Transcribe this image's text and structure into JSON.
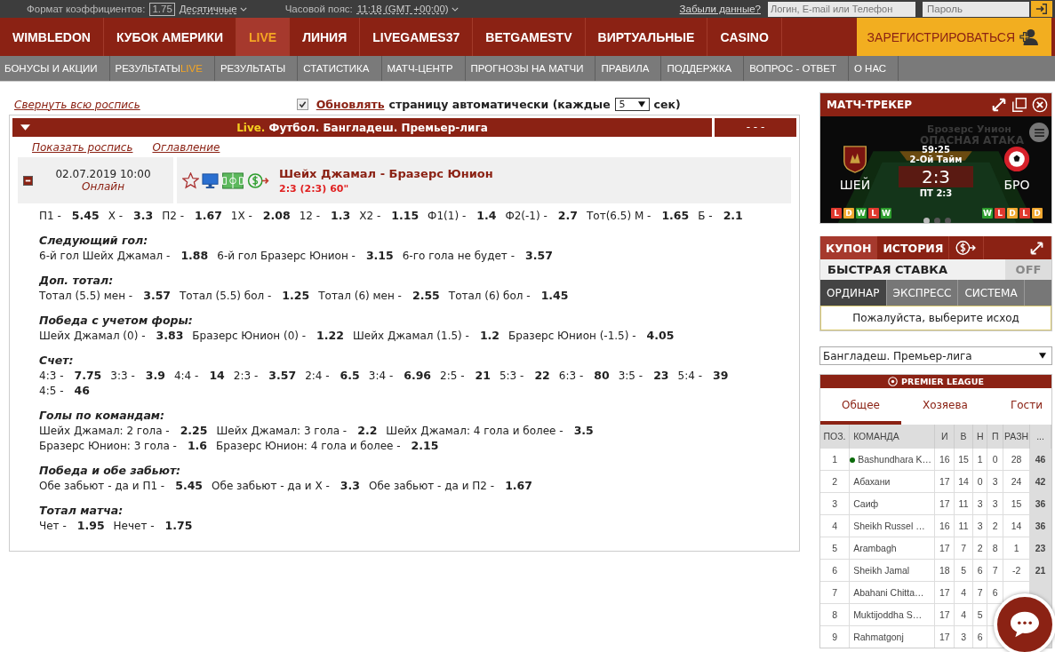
{
  "top_bar": {
    "odds_format_label": "Формат коэффициентов:",
    "odds_sample": "1.75",
    "odds_format": "Десятичные",
    "timezone_label": "Часовой пояс:",
    "timezone": "11:18 (GMT +00:00)",
    "forgot_link": "Забыли данные?",
    "login_placeholder": "Логин, E-mail или Телефон",
    "password_placeholder": "Пароль"
  },
  "main_nav": [
    {
      "label": "WIMBLEDON",
      "selected": false
    },
    {
      "label": "КУБОК АМЕРИКИ",
      "selected": false
    },
    {
      "label": "LIVE",
      "selected": true
    },
    {
      "label": "ЛИНИЯ",
      "selected": false
    },
    {
      "label": "LIVEGAMES37",
      "selected": false
    },
    {
      "label": "BETGAMESTV",
      "selected": false
    },
    {
      "label": "ВИРТУАЛЬНЫЕ",
      "selected": false
    },
    {
      "label": "CASINO",
      "selected": false
    }
  ],
  "register_button": "ЗАРЕГИСТРИРОВАТЬСЯ",
  "sub_nav": [
    {
      "label": "БОНУСЫ И АКЦИИ"
    },
    {
      "label": "РЕЗУЛЬТАТЫ",
      "accent": "LIVE"
    },
    {
      "label": "РЕЗУЛЬТАТЫ"
    },
    {
      "label": "СТАТИСТИКА"
    },
    {
      "label": "МАТЧ-ЦЕНТР"
    },
    {
      "label": "ПРОГНОЗЫ НА МАТЧИ"
    },
    {
      "label": "ПРАВИЛА"
    },
    {
      "label": "ПОДДЕРЖКА"
    },
    {
      "label": "ВОПРОС - ОТВЕТ"
    },
    {
      "label": "О НАС"
    }
  ],
  "collapse_link": "Свернуть всю роспись",
  "auto_refresh": {
    "checked": true,
    "link": "Обновлять",
    "text": "страницу автоматически (каждые",
    "interval": "5",
    "unit": "сек)"
  },
  "league_header": {
    "prefix": "Live.",
    "title": "Футбол. Бангладеш. Премьер-лига",
    "extra": "- - -"
  },
  "league_links": [
    "Показать роспись",
    "Оглавление"
  ],
  "event": {
    "date": "02.07.2019 10:00",
    "status": "Онлайн",
    "name": "Шейх Джамал - Бразерс Юнион",
    "score": "2:3 (2:3) 60\""
  },
  "markets": [
    {
      "items": [
        {
          "label": "П1 -",
          "odd": "5.45"
        },
        {
          "label": "Х -",
          "odd": "3.3"
        },
        {
          "label": "П2 -",
          "odd": "1.67"
        },
        {
          "label": "1Х -",
          "odd": "2.08"
        },
        {
          "label": "12 -",
          "odd": "1.3"
        },
        {
          "label": "Х2 -",
          "odd": "1.15"
        },
        {
          "label": "Ф1(1) -",
          "odd": "1.4"
        },
        {
          "label": "Ф2(-1) -",
          "odd": "2.7"
        },
        {
          "label": "Тот(6.5) М -",
          "odd": "1.65"
        },
        {
          "label": "Б -",
          "odd": "2.1"
        }
      ]
    },
    {
      "title": "Следующий гол:",
      "items": [
        {
          "label": "6-й гол Шейх Джамал -",
          "odd": "1.88"
        },
        {
          "label": "6-й гол Бразерс Юнион -",
          "odd": "3.15"
        },
        {
          "label": "6-го гола не будет -",
          "odd": "3.57"
        }
      ]
    },
    {
      "title": "Доп. тотал:",
      "items": [
        {
          "label": "Тотал (5.5) мен -",
          "odd": "3.57"
        },
        {
          "label": "Тотал (5.5) бол -",
          "odd": "1.25"
        },
        {
          "label": "Тотал (6) мен -",
          "odd": "2.55"
        },
        {
          "label": "Тотал (6) бол -",
          "odd": "1.45"
        }
      ]
    },
    {
      "title": "Победа с учетом форы:",
      "items": [
        {
          "label": "Шейх Джамал (0) -",
          "odd": "3.83"
        },
        {
          "label": "Бразерс Юнион (0) -",
          "odd": "1.22"
        },
        {
          "label": "Шейх Джамал (1.5) -",
          "odd": "1.2"
        },
        {
          "label": "Бразерс Юнион (-1.5) -",
          "odd": "4.05"
        }
      ]
    },
    {
      "title": "Счет:",
      "items": [
        {
          "label": "4:3 -",
          "odd": "7.75"
        },
        {
          "label": "3:3 -",
          "odd": "3.9"
        },
        {
          "label": "4:4 -",
          "odd": "14"
        },
        {
          "label": "2:3 -",
          "odd": "3.57"
        },
        {
          "label": "2:4 -",
          "odd": "6.5"
        },
        {
          "label": "3:4 -",
          "odd": "6.96"
        },
        {
          "label": "2:5 -",
          "odd": "21"
        },
        {
          "label": "5:3 -",
          "odd": "22"
        },
        {
          "label": "6:3 -",
          "odd": "80"
        },
        {
          "label": "3:5 -",
          "odd": "23"
        },
        {
          "label": "5:4 -",
          "odd": "39"
        },
        {
          "label": "4:5 -",
          "odd": "46"
        }
      ]
    },
    {
      "title": "Голы по командам:",
      "items": [
        {
          "label": "Шейх Джамал: 2 гола -",
          "odd": "2.25"
        },
        {
          "label": "Шейх Джамал: 3 гола -",
          "odd": "2.2"
        },
        {
          "label": "Шейх Джамал: 4 гола и более -",
          "odd": "3.5"
        },
        {
          "label": "Бразерс Юнион: 3 гола -",
          "odd": "1.6"
        },
        {
          "label": "Бразерс Юнион: 4 гола и более -",
          "odd": "2.15"
        }
      ]
    },
    {
      "title": "Победа и обе забьют:",
      "items": [
        {
          "label": "Обе забьют - да и П1 -",
          "odd": "5.45"
        },
        {
          "label": "Обе забьют - да и Х -",
          "odd": "3.3"
        },
        {
          "label": "Обе забьют - да и П2 -",
          "odd": "1.67"
        }
      ]
    },
    {
      "title": "Тотал матча:",
      "items": [
        {
          "label": "Чет -",
          "odd": "1.95"
        },
        {
          "label": "Нечет -",
          "odd": "1.75"
        }
      ]
    }
  ],
  "tracker": {
    "title": "МАТЧ-ТРЕКЕР",
    "team_faded": "Брозерс Унион",
    "event_faded": "ОПАСНАЯ АТАКА",
    "clock": "59:25",
    "period": "2-Ой Тайм",
    "home": "ШЕЙ",
    "away": "БРО",
    "score": "2:3",
    "half": "ПТ 2:3",
    "home_form": [
      {
        "letter": "L",
        "color": "#e03a2f"
      },
      {
        "letter": "D",
        "color": "#f0a830"
      },
      {
        "letter": "W",
        "color": "#2e9e2e"
      },
      {
        "letter": "L",
        "color": "#e03a2f"
      },
      {
        "letter": "W",
        "color": "#2e9e2e"
      }
    ],
    "away_form": [
      {
        "letter": "W",
        "color": "#2e9e2e"
      },
      {
        "letter": "L",
        "color": "#e03a2f"
      },
      {
        "letter": "D",
        "color": "#f0a830"
      },
      {
        "letter": "L",
        "color": "#e03a2f"
      },
      {
        "letter": "D",
        "color": "#f0a830"
      }
    ],
    "pages": [
      {
        "selected": true
      },
      {
        "selected": false
      },
      {
        "selected": false
      }
    ]
  },
  "coupon": {
    "tabs": [
      {
        "label": "КУПОН",
        "selected": true
      },
      {
        "label": "ИСТОРИЯ",
        "selected": false
      }
    ],
    "quick_bet_label": "БЫСТРАЯ СТАВКА",
    "quick_bet": {
      "on": false,
      "label": "OFF"
    },
    "bet_types": [
      {
        "label": "ОРДИНАР",
        "selected": true
      },
      {
        "label": "ЭКСПРЕСС",
        "selected": false
      },
      {
        "label": "СИСТЕМА",
        "selected": false
      }
    ],
    "message": "Пожалуйста, выберите исход"
  },
  "league_select": "Бангладеш. Премьер-лига",
  "standings": {
    "title": "PREMIER LEAGUE",
    "tabs": [
      {
        "label": "Общее",
        "selected": true
      },
      {
        "label": "Хозяева",
        "selected": false
      },
      {
        "label": "Гости",
        "selected": false
      }
    ],
    "columns": [
      "ПОЗ.",
      "КОМАНДА",
      "И",
      "В",
      "Н",
      "П",
      "РАЗН",
      "..."
    ],
    "rows": [
      {
        "cells": [
          "1",
          "Bashundhara K…",
          "16",
          "15",
          "1",
          "0",
          "28",
          "46"
        ],
        "color": "#0b6b0b"
      },
      {
        "cells": [
          "2",
          "Абахани",
          "17",
          "14",
          "0",
          "3",
          "24",
          "42"
        ]
      },
      {
        "cells": [
          "3",
          "Саиф",
          "17",
          "11",
          "3",
          "3",
          "15",
          "36"
        ]
      },
      {
        "cells": [
          "4",
          "Sheikh Russel …",
          "16",
          "11",
          "3",
          "2",
          "14",
          "36"
        ]
      },
      {
        "cells": [
          "5",
          "Arambagh",
          "17",
          "7",
          "2",
          "8",
          "1",
          "23"
        ]
      },
      {
        "cells": [
          "6",
          "Sheikh Jamal",
          "18",
          "5",
          "6",
          "7",
          "-2",
          "21"
        ]
      },
      {
        "cells": [
          "7",
          "Abahani Chitta…",
          "17",
          "4",
          "7",
          "6"
        ]
      },
      {
        "cells": [
          "8",
          "Muktijoddha S…",
          "17",
          "4",
          "5"
        ]
      },
      {
        "cells": [
          "9",
          "Rahmatgonj",
          "17",
          "3",
          "6"
        ]
      }
    ]
  }
}
